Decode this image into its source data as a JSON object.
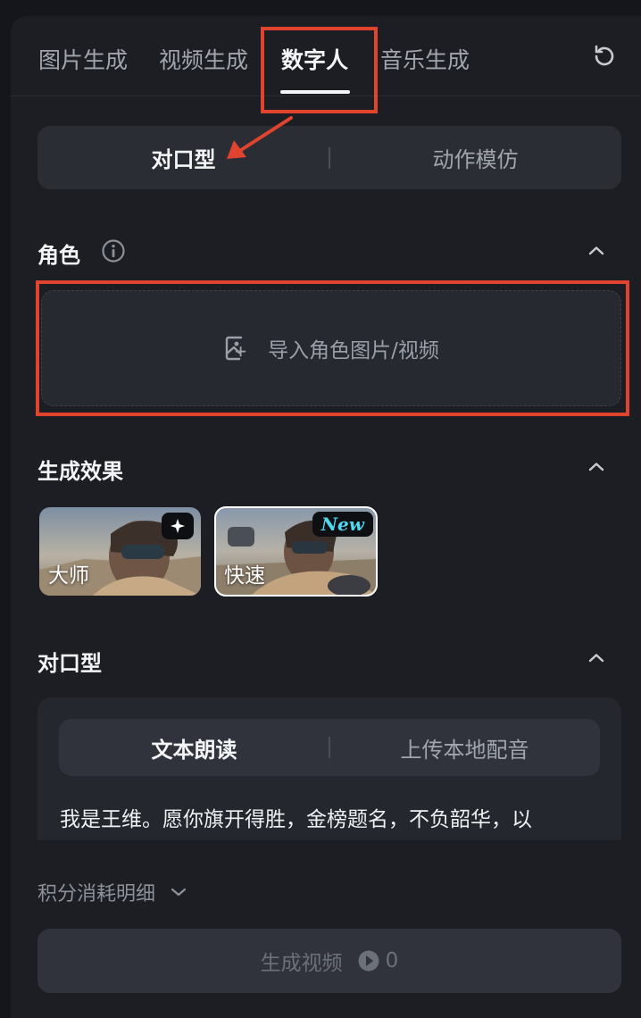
{
  "tabs": [
    {
      "label": "图片生成"
    },
    {
      "label": "视频生成"
    },
    {
      "label": "数字人",
      "active": true
    },
    {
      "label": "音乐生成"
    }
  ],
  "icons": {
    "refresh": "refresh-icon",
    "info": "info-icon",
    "collapse": "chevron-up-icon",
    "upload": "image-add-icon",
    "star": "sparkle-icon",
    "expand": "chevron-down-icon",
    "credit": "credit-coin-icon"
  },
  "mode_toggle": {
    "options": [
      "对口型",
      "动作模仿"
    ],
    "selected": "对口型"
  },
  "role_section": {
    "title": "角色",
    "upload_label": "导入角色图片/视频"
  },
  "effect_section": {
    "title": "生成效果",
    "options": [
      {
        "label": "大师",
        "badge": "sparkle"
      },
      {
        "label": "快速",
        "badge": "New",
        "selected": true
      }
    ]
  },
  "lipsync_section": {
    "title": "对口型",
    "source_toggle": {
      "options": [
        "文本朗读",
        "上传本地配音"
      ],
      "selected": "文本朗读"
    },
    "text": "我是王维。愿你旗开得胜，金榜题名，不负韶华，以"
  },
  "footer": {
    "credits_label": "积分消耗明细",
    "generate_label": "生成视频",
    "cost": "0"
  },
  "colors": {
    "annotation": "#e0442f",
    "new_badge": "#4fd8ef",
    "background": "#1c1e24"
  }
}
